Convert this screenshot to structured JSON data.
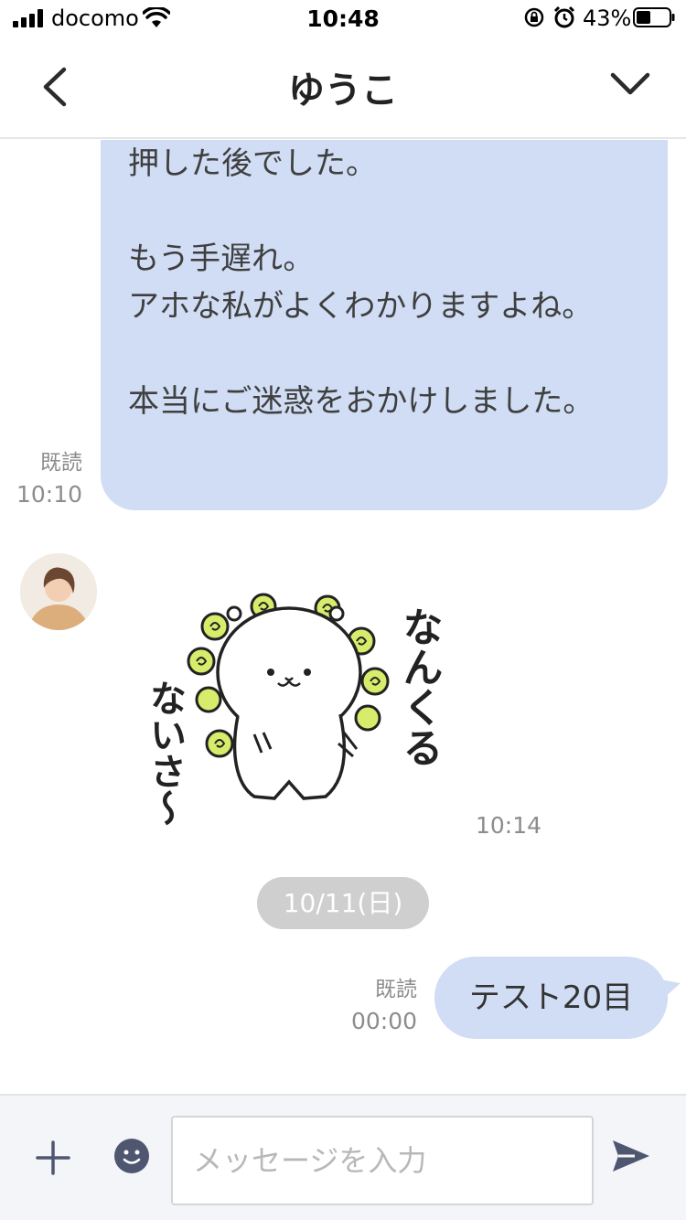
{
  "status_bar": {
    "carrier": "docomo",
    "time": "10:48",
    "battery_percent": "43%"
  },
  "header": {
    "title": "ゆうこ"
  },
  "messages": [
    {
      "type": "text",
      "direction": "sent",
      "text": "押した後でした。\n\nもう手遅れ。\nアホな私がよくわかりますよね。\n\n本当にご迷惑をおかけしました。",
      "read_label": "既読",
      "time": "10:10"
    },
    {
      "type": "sticker",
      "direction": "received",
      "sticker_text_right": "なんくる",
      "sticker_text_left": "ないさ～",
      "time": "10:14"
    },
    {
      "type": "date",
      "label": "10/11(日)"
    },
    {
      "type": "text",
      "direction": "sent",
      "text": "テスト20目",
      "read_label": "既読",
      "time": "00:00"
    }
  ],
  "input": {
    "placeholder": "メッセージを入力",
    "value": ""
  },
  "colors": {
    "sent_bubble": "#d0ddf4",
    "date_pill": "#cfcfcf",
    "input_bar": "#f4f5f8"
  }
}
